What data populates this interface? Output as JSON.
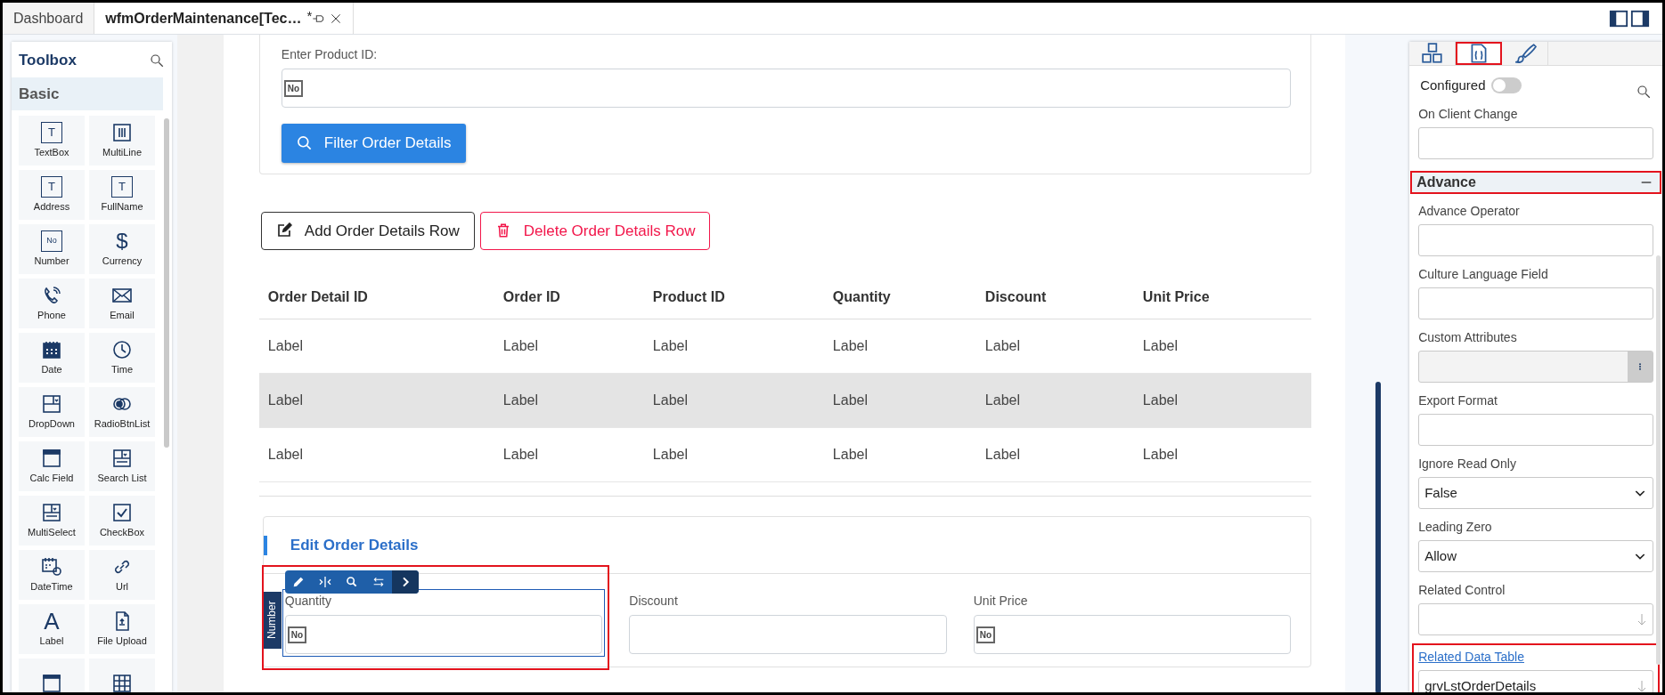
{
  "tabs": [
    {
      "label": "Dashboard",
      "selected": false
    },
    {
      "label": "wfmOrderMaintenance[Tec…",
      "selected": true,
      "modified_mark": "*"
    }
  ],
  "toolbox": {
    "title": "Toolbox",
    "group": "Basic",
    "items": [
      {
        "label": "TextBox",
        "glyph": "T"
      },
      {
        "label": "MultiLine"
      },
      {
        "label": "Address",
        "glyph": "T"
      },
      {
        "label": "FullName",
        "glyph": "T"
      },
      {
        "label": "Number",
        "glyph": "No"
      },
      {
        "label": "Currency",
        "glyph": "$"
      },
      {
        "label": "Phone"
      },
      {
        "label": "Email"
      },
      {
        "label": "Date"
      },
      {
        "label": "Time"
      },
      {
        "label": "DropDown"
      },
      {
        "label": "RadioBtnList"
      },
      {
        "label": "Calc Field"
      },
      {
        "label": "Search List"
      },
      {
        "label": "MultiSelect"
      },
      {
        "label": "CheckBox"
      },
      {
        "label": "DateTime"
      },
      {
        "label": "Url"
      },
      {
        "label": "Label",
        "glyph": "A"
      },
      {
        "label": "File Upload"
      },
      {
        "kind": "cut"
      },
      {
        "kind": "cut"
      }
    ]
  },
  "filter": {
    "label": "Enter Product ID:",
    "badge": "No",
    "button": "Filter Order Details"
  },
  "actions": [
    {
      "label": "Add Order Details Row",
      "kind": "add"
    },
    {
      "label": "Delete Order Details Row",
      "kind": "delete"
    }
  ],
  "table": {
    "columns": [
      "Order Detail ID",
      "Order ID",
      "Product ID",
      "Quantity",
      "Discount",
      "Unit Price"
    ],
    "rows": [
      {
        "selected": false,
        "cells": [
          "Label",
          "Label",
          "Label",
          "Label",
          "Label",
          "Label"
        ]
      },
      {
        "selected": true,
        "cells": [
          "Label",
          "Label",
          "Label",
          "Label",
          "Label",
          "Label"
        ]
      },
      {
        "selected": false,
        "cells": [
          "Label",
          "Label",
          "Label",
          "Label",
          "Label",
          "Label"
        ]
      }
    ]
  },
  "edit_card": {
    "title": "Edit Order Details",
    "fields": [
      {
        "label": "Quantity",
        "badge": "No",
        "selected": true,
        "type_tag": "Number"
      },
      {
        "label": "Discount",
        "selected": false
      },
      {
        "label": "Unit Price",
        "badge": "No",
        "selected": false
      }
    ]
  },
  "properties": {
    "tabs": [
      {
        "kind": "layout",
        "selected": false
      },
      {
        "kind": "code",
        "selected": true
      },
      {
        "kind": "style",
        "selected": false
      }
    ],
    "configured": {
      "label": "Configured",
      "on": false
    },
    "fields_top": [
      {
        "label": "On Client Change",
        "kind": "input"
      }
    ],
    "section": {
      "title": "Advance",
      "expanded": true,
      "outlined": true
    },
    "fields": [
      {
        "label": "Advance Operator",
        "kind": "input"
      },
      {
        "label": "Culture Language Field",
        "kind": "input"
      },
      {
        "label": "Custom Attributes",
        "kind": "dots"
      },
      {
        "label": "Export Format",
        "kind": "input"
      },
      {
        "label": "Ignore Read Only",
        "kind": "select",
        "value": "False"
      },
      {
        "label": "Leading Zero",
        "kind": "select",
        "value": "Allow"
      },
      {
        "label": "Related Control",
        "kind": "lookup"
      },
      {
        "label": "Related Data Table",
        "kind": "lookup",
        "value": "grvLstOrderDetails",
        "link": true,
        "outlined": true
      }
    ]
  }
}
